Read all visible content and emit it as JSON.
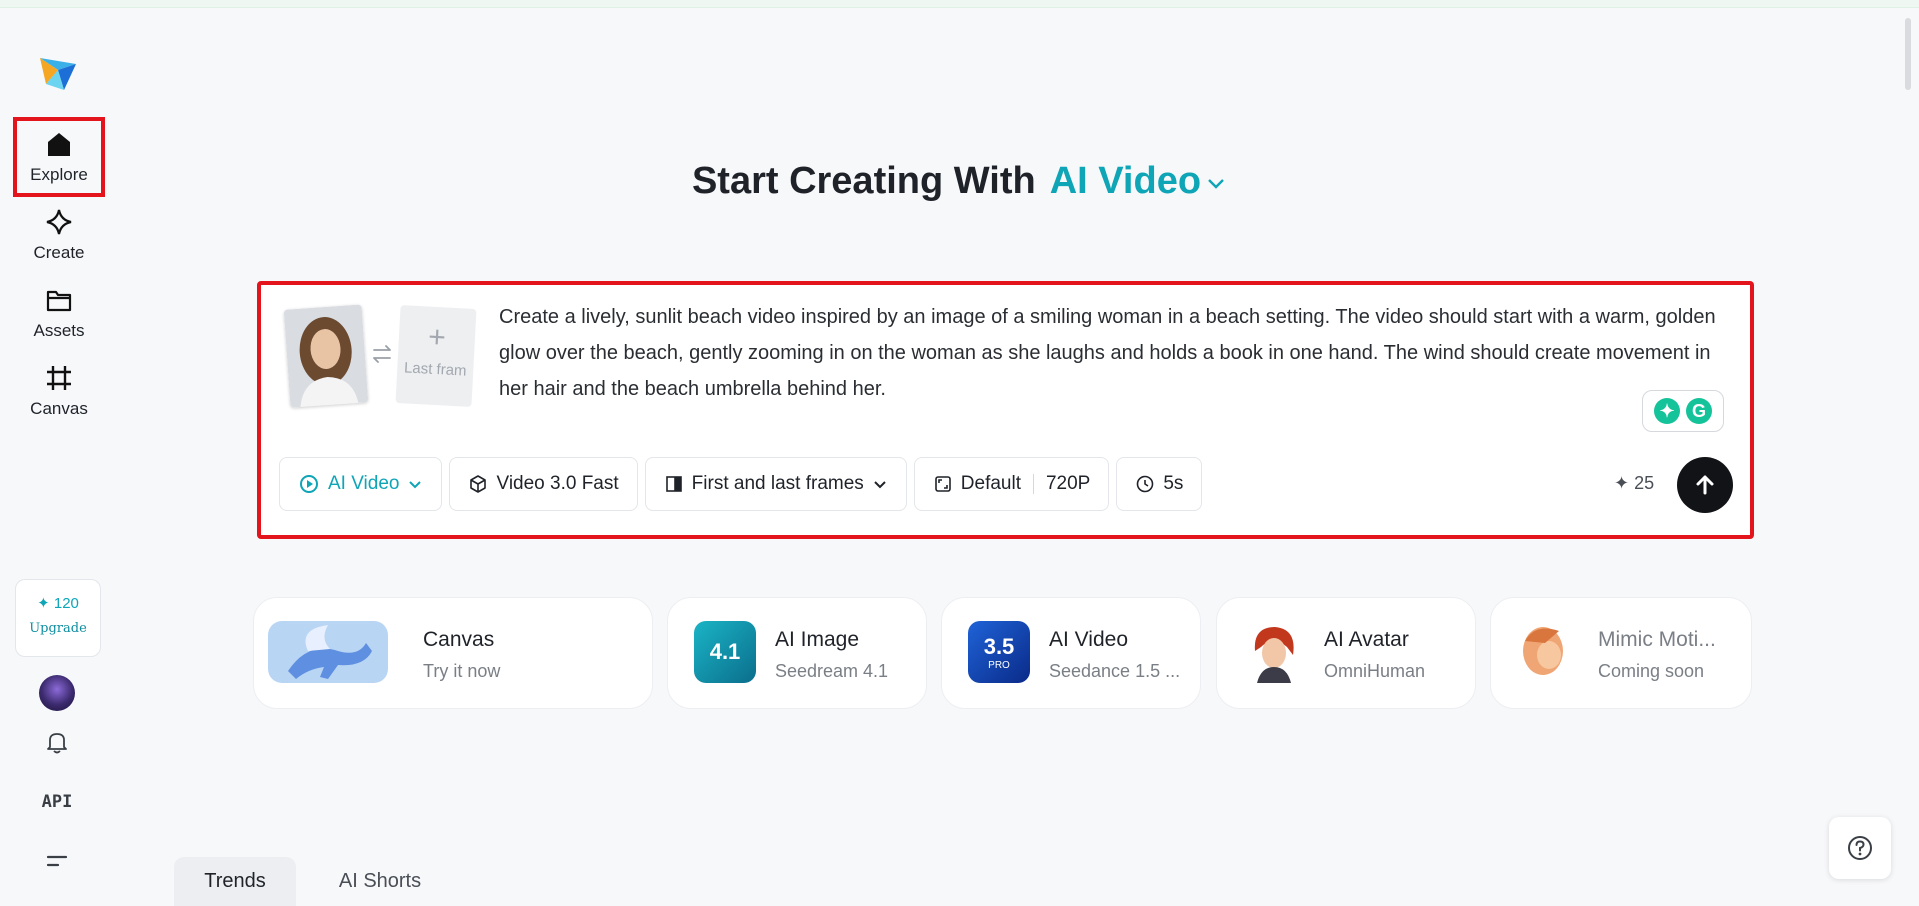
{
  "sidebar": {
    "nav": [
      {
        "label": "Explore",
        "icon": "home-icon"
      },
      {
        "label": "Create",
        "icon": "diamond-icon"
      },
      {
        "label": "Assets",
        "icon": "folder-icon"
      },
      {
        "label": "Canvas",
        "icon": "canvas-icon"
      }
    ],
    "credits": "✦ 120",
    "upgrade_label": "Upgrade",
    "api_label": "API"
  },
  "heading": {
    "prefix": "Start Creating With",
    "mode": "AI Video"
  },
  "prompt": {
    "last_frame_label": "Last fram",
    "text": "Create a lively, sunlit beach video inspired by an image of a smiling woman in a beach setting. The video should start with a warm, golden glow over the beach, gently zooming in on the woman as she laughs and holds a book in one hand. The wind should create movement in her hair and the beach umbrella behind her."
  },
  "toolbar": {
    "mode": "AI Video",
    "model": "Video 3.0 Fast",
    "frames": "First and last frames",
    "ratio": "Default",
    "resolution": "720P",
    "duration": "5s",
    "cost": "✦ 25"
  },
  "features": [
    {
      "title": "Canvas",
      "subtitle": "Try it now"
    },
    {
      "title": "AI Image",
      "subtitle": "Seedream 4.1",
      "badge": "4.1"
    },
    {
      "title": "AI Video",
      "subtitle": "Seedance 1.5 ...",
      "badge": "3.5",
      "badge_sub": "PRO"
    },
    {
      "title": "AI Avatar",
      "subtitle": "OmniHuman"
    },
    {
      "title": "Mimic Moti...",
      "subtitle": "Coming soon"
    }
  ],
  "tabs": [
    "Trends",
    "AI Shorts"
  ],
  "colors": {
    "accent": "#0ea5b7",
    "highlight": "#e3141c"
  }
}
